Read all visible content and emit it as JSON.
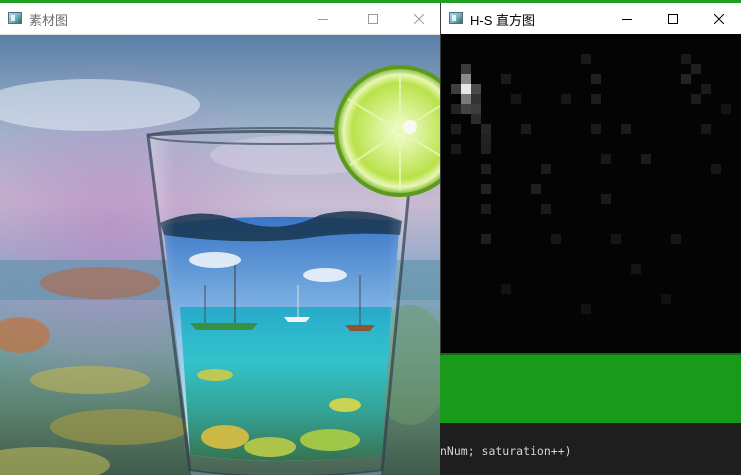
{
  "left_window": {
    "title": "素材图",
    "image_alt": "Glass of sea water with sailing boats and a lime slice"
  },
  "right_window": {
    "title": "H-S 直方图"
  },
  "background": {
    "code_text": "nNum; saturation++)"
  },
  "titlebar_buttons": {
    "minimize": "minimize-icon",
    "maximize": "maximize-icon",
    "close": "close-icon"
  },
  "colors": {
    "accent_green": "#1f9e1f",
    "histogram_bg": "#040404",
    "editor_bg": "#1e1e1e"
  }
}
